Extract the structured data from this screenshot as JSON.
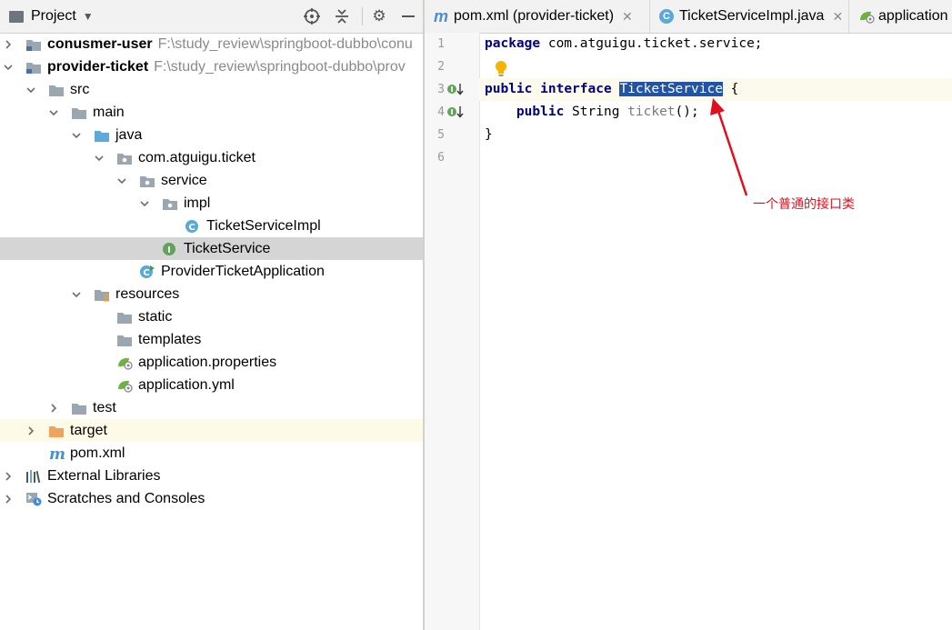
{
  "project_panel": {
    "title": "Project",
    "tree": [
      {
        "depth": 0,
        "expanded": false,
        "icon": "module-folder-icon",
        "label": "conusmer-user",
        "bold": true,
        "path": "F:\\study_review\\springboot-dubbo\\conu"
      },
      {
        "depth": 0,
        "expanded": true,
        "icon": "module-folder-icon",
        "label": "provider-ticket",
        "bold": true,
        "path": "F:\\study_review\\springboot-dubbo\\prov"
      },
      {
        "depth": 1,
        "expanded": true,
        "icon": "folder-icon",
        "label": "src"
      },
      {
        "depth": 2,
        "expanded": true,
        "icon": "folder-icon",
        "label": "main"
      },
      {
        "depth": 3,
        "expanded": true,
        "icon": "source-folder-icon",
        "label": "java"
      },
      {
        "depth": 4,
        "expanded": true,
        "icon": "package-icon",
        "label": "com.atguigu.ticket"
      },
      {
        "depth": 5,
        "expanded": true,
        "icon": "package-icon",
        "label": "service"
      },
      {
        "depth": 6,
        "expanded": true,
        "icon": "package-icon",
        "label": "impl"
      },
      {
        "depth": 7,
        "expanded": null,
        "icon": "class-icon",
        "label": "TicketServiceImpl"
      },
      {
        "depth": 6,
        "expanded": null,
        "icon": "interface-icon",
        "label": "TicketService",
        "selected": true
      },
      {
        "depth": 5,
        "expanded": null,
        "icon": "spring-boot-class-icon",
        "label": "ProviderTicketApplication"
      },
      {
        "depth": 3,
        "expanded": true,
        "icon": "resources-folder-icon",
        "label": "resources"
      },
      {
        "depth": 4,
        "expanded": null,
        "icon": "folder-icon",
        "label": "static"
      },
      {
        "depth": 4,
        "expanded": null,
        "icon": "folder-icon",
        "label": "templates"
      },
      {
        "depth": 4,
        "expanded": null,
        "icon": "spring-config-icon",
        "label": "application.properties"
      },
      {
        "depth": 4,
        "expanded": null,
        "icon": "spring-config-icon",
        "label": "application.yml"
      },
      {
        "depth": 2,
        "expanded": false,
        "icon": "folder-icon",
        "label": "test"
      },
      {
        "depth": 1,
        "expanded": false,
        "icon": "excluded-folder-icon",
        "label": "target",
        "excluded": true
      },
      {
        "depth": 1,
        "expanded": null,
        "icon": "maven-icon",
        "label": "pom.xml"
      },
      {
        "depth": 0,
        "expanded": false,
        "icon": "libraries-icon",
        "label": "External Libraries"
      },
      {
        "depth": 0,
        "expanded": false,
        "icon": "scratches-icon",
        "label": "Scratches and Consoles"
      }
    ]
  },
  "editor": {
    "tabs": [
      {
        "icon": "maven-icon",
        "label": "pom.xml (provider-ticket)",
        "closable": true,
        "active": false
      },
      {
        "icon": "class-icon",
        "label": "TicketServiceImpl.java",
        "closable": true,
        "active": false
      },
      {
        "icon": "spring-config-icon",
        "label": "application",
        "closable": false,
        "active": false
      }
    ],
    "line_numbers": [
      "1",
      "2",
      "3",
      "4",
      "5",
      "6"
    ],
    "code": {
      "line1_kw": "package",
      "line1_rest": " com.atguigu.ticket.service;",
      "line3_kw1": "public",
      "line3_kw2": "interface",
      "line3_selected": "TicketService",
      "line3_rest": " {",
      "line4_kw": "public",
      "line4_type": " String ",
      "line4_method": "ticket",
      "line4_rest": "();",
      "line5": "}"
    },
    "annotation": "一个普通的接口类",
    "colors": {
      "keyword": "#000080",
      "selection": "#2153a8",
      "annotation": "#e0101f",
      "selected_row": "#d5d5d5"
    }
  }
}
